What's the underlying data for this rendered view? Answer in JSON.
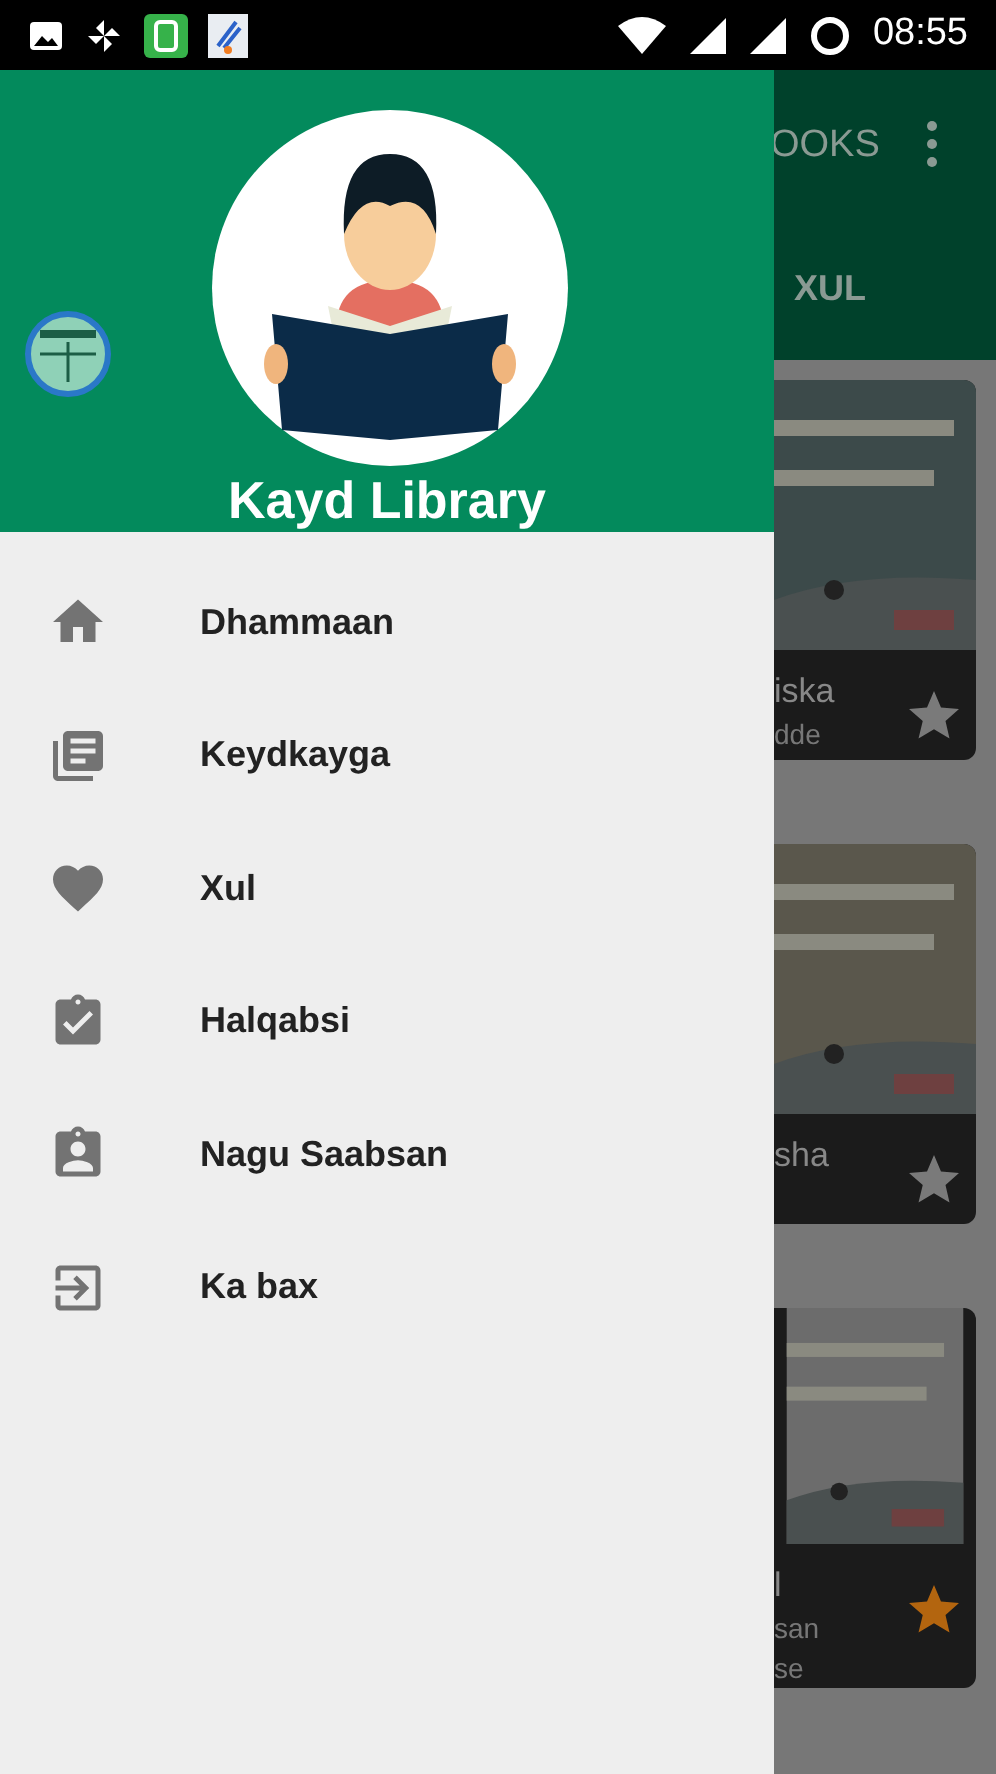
{
  "status_bar": {
    "time": "08:55"
  },
  "background": {
    "app_bar_title": "OOKS",
    "tabs": [
      {
        "label": "XUL",
        "selected": false
      }
    ],
    "books": [
      {
        "lines": [
          "iska",
          "dde"
        ],
        "starred": false
      },
      {
        "lines": [
          "sha"
        ],
        "starred": false
      },
      {
        "lines": [
          "l",
          "san",
          "se"
        ],
        "starred": true
      }
    ]
  },
  "drawer": {
    "title": "Kayd Library",
    "items": [
      {
        "kind": "home",
        "label": "Dhammaan",
        "selected": false
      },
      {
        "kind": "library",
        "label": "Keydkayga",
        "selected": false
      },
      {
        "kind": "heart",
        "label": "Xul",
        "selected": false
      },
      {
        "kind": "clipboard-check",
        "label": "Halqabsi",
        "selected": false
      },
      {
        "kind": "clipboard-person",
        "label": "Nagu Saabsan",
        "selected": false
      },
      {
        "kind": "exit",
        "label": "Ka bax",
        "selected": false
      }
    ]
  }
}
